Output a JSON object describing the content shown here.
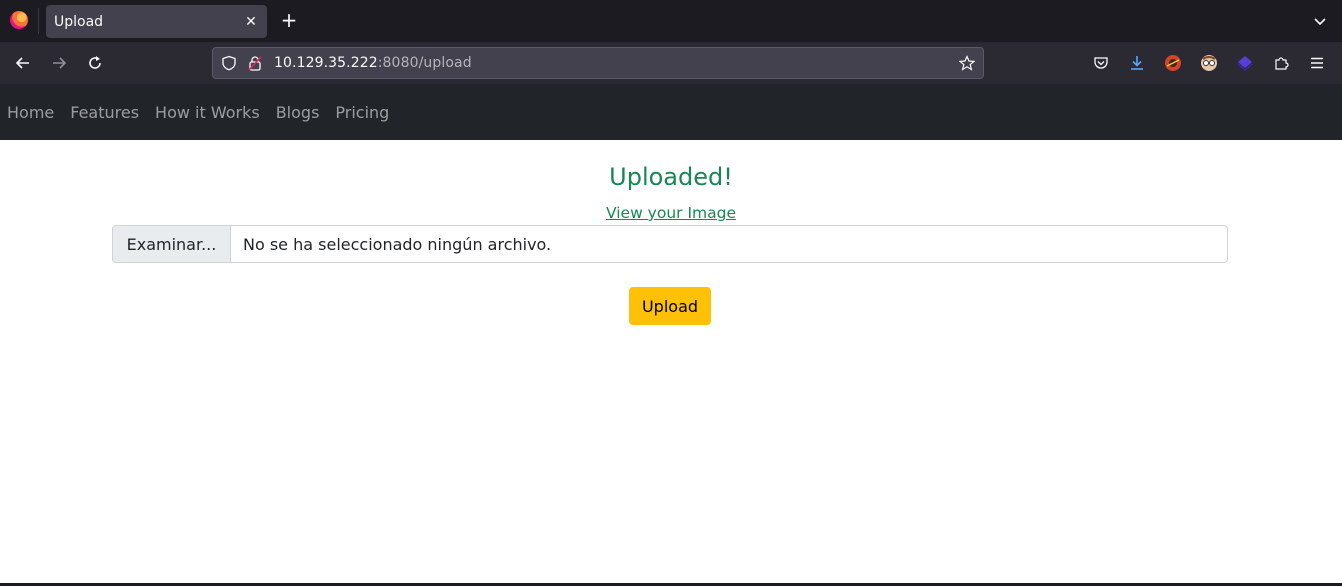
{
  "browser": {
    "tab_title": "Upload",
    "tab_close": "✕",
    "new_tab": "+",
    "url_host": "10.129.35.222",
    "url_rest": ":8080/upload"
  },
  "site_nav": {
    "items": [
      "Home",
      "Features",
      "How it Works",
      "Blogs",
      "Pricing"
    ]
  },
  "main": {
    "status_text": "Uploaded!",
    "view_link": "View your Image",
    "file_button": "Examinar...",
    "file_status": "No se ha seleccionado ningún archivo.",
    "upload_button": "Upload"
  },
  "colors": {
    "success": "#198754",
    "upload_button_bg": "#ffc107",
    "nav_bg": "#212529"
  },
  "icons": [
    "firefox-logo",
    "back-icon",
    "forward-icon",
    "reload-icon",
    "shield-icon",
    "lock-icon",
    "star-icon",
    "pocket-icon",
    "download-icon",
    "extension-icon",
    "menu-icon"
  ]
}
